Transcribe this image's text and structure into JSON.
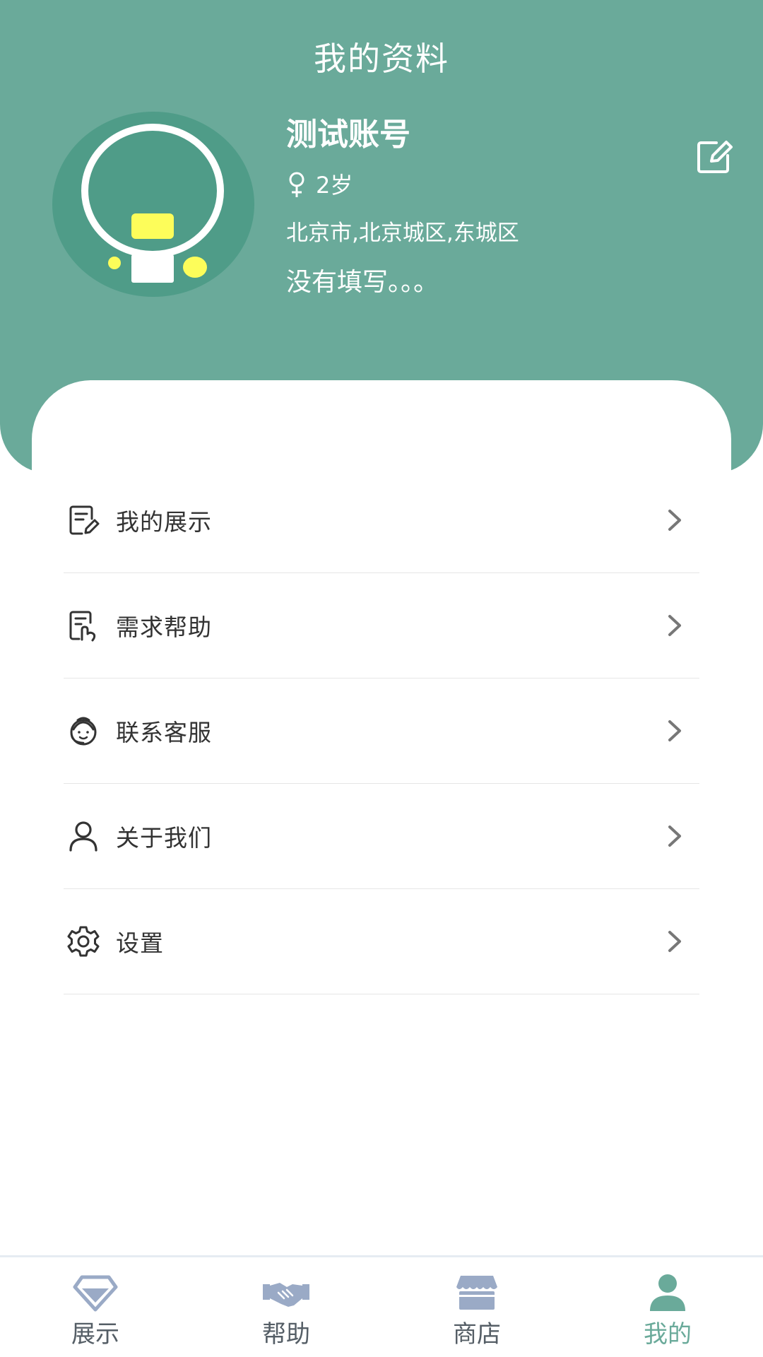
{
  "header": {
    "title": "我的资料"
  },
  "profile": {
    "name": "测试账号",
    "gender_symbol": "♀",
    "age": "2岁",
    "location": "北京市,北京城区,东城区",
    "bio": "没有填写。。。"
  },
  "menu": {
    "items": [
      {
        "label": "我的展示",
        "icon": "edit-document-icon"
      },
      {
        "label": "需求帮助",
        "icon": "request-document-icon"
      },
      {
        "label": "联系客服",
        "icon": "customer-service-icon"
      },
      {
        "label": "关于我们",
        "icon": "user-icon"
      },
      {
        "label": "设置",
        "icon": "gear-icon"
      }
    ]
  },
  "bottom_nav": {
    "items": [
      {
        "label": "展示",
        "icon": "diamond-icon"
      },
      {
        "label": "帮助",
        "icon": "handshake-icon"
      },
      {
        "label": "商店",
        "icon": "shop-icon"
      },
      {
        "label": "我的",
        "icon": "person-icon",
        "active": true
      }
    ]
  },
  "colors": {
    "accent": "#6aaa9a",
    "nav_inactive_icon": "#9aaac6",
    "text_primary": "#333333"
  }
}
